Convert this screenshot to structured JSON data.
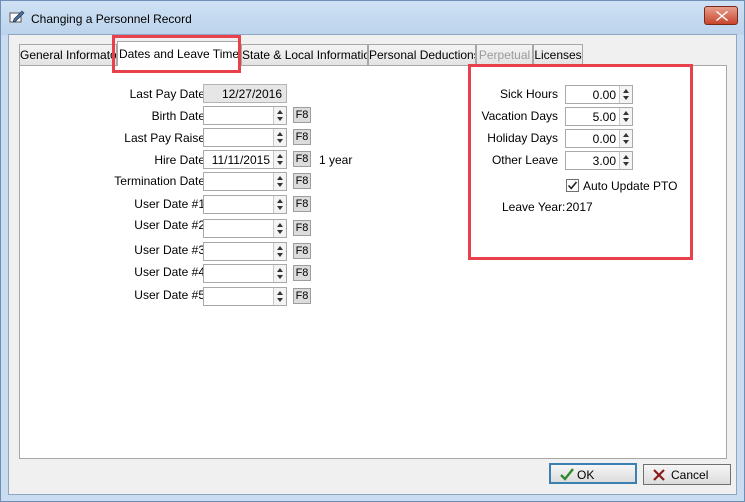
{
  "window": {
    "title": "Changing a Personnel Record"
  },
  "icons": {
    "title": "edit-record-icon",
    "close": "close-x-icon",
    "ok": "check-icon",
    "cancel": "x-icon",
    "checkbox": "checkmark-icon"
  },
  "colors": {
    "highlight": "#e8414c",
    "ok_check": "#2f8a2f",
    "cancel_x": "#8b1a1a"
  },
  "tabs": [
    {
      "label": "General Informaton",
      "active": false,
      "enabled": true
    },
    {
      "label": "Dates and Leave Time",
      "active": true,
      "enabled": true
    },
    {
      "label": "State & Local Information",
      "active": false,
      "enabled": true
    },
    {
      "label": "Personal Deductions",
      "active": false,
      "enabled": true
    },
    {
      "label": "Perpetual",
      "active": false,
      "enabled": false
    },
    {
      "label": "Licenses",
      "active": false,
      "enabled": true
    }
  ],
  "dates": {
    "f8_label": "F8",
    "last_pay_date": {
      "label": "Last Pay Date",
      "value": "12/27/2016"
    },
    "birth_date": {
      "label": "Birth Date",
      "value": ""
    },
    "last_pay_raise": {
      "label": "Last Pay Raise",
      "value": ""
    },
    "hire_date": {
      "label": "Hire Date",
      "value": "11/11/2015",
      "note": "1 year"
    },
    "termination_date": {
      "label": "Termination Date",
      "value": ""
    },
    "user_date_1": {
      "label": "User Date #1",
      "value": ""
    },
    "user_date_2": {
      "label": "User Date #2",
      "value": ""
    },
    "user_date_3": {
      "label": "User Date #3",
      "value": ""
    },
    "user_date_4": {
      "label": "User Date #4",
      "value": ""
    },
    "user_date_5": {
      "label": "User Date #5",
      "value": ""
    }
  },
  "leave": {
    "sick_hours": {
      "label": "Sick Hours",
      "value": "0.00"
    },
    "vacation_days": {
      "label": "Vacation Days",
      "value": "5.00"
    },
    "holiday_days": {
      "label": "Holiday Days",
      "value": "0.00"
    },
    "other_leave": {
      "label": "Other Leave",
      "value": "3.00"
    },
    "auto_update": {
      "label": "Auto Update PTO",
      "checked": true
    },
    "leave_year": {
      "label": "Leave Year:",
      "value": "2017"
    }
  },
  "buttons": {
    "ok": "OK",
    "cancel": "Cancel"
  }
}
